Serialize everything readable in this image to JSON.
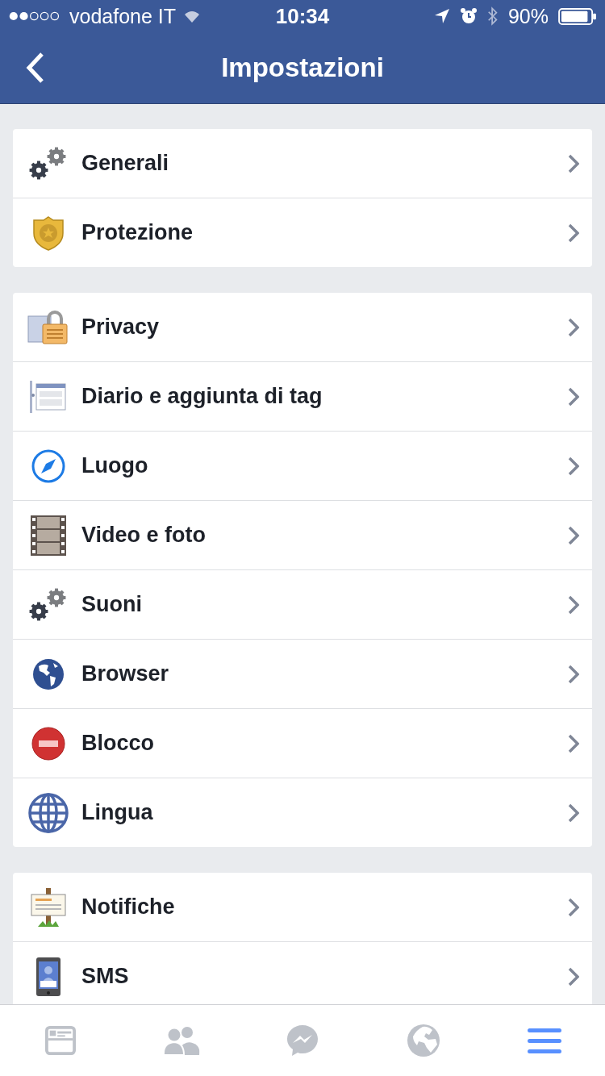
{
  "status_bar": {
    "carrier": "vodafone IT",
    "time": "10:34",
    "battery": "90%"
  },
  "nav_bar": {
    "title": "Impostazioni"
  },
  "sections": [
    {
      "items": [
        {
          "kind": "gears",
          "label": "Generali"
        },
        {
          "kind": "badge",
          "label": "Protezione"
        }
      ]
    },
    {
      "items": [
        {
          "kind": "lock",
          "label": "Privacy"
        },
        {
          "kind": "timeline",
          "label": "Diario e aggiunta di tag"
        },
        {
          "kind": "compass",
          "label": "Luogo"
        },
        {
          "kind": "film",
          "label": "Video e foto"
        },
        {
          "kind": "gears",
          "label": "Suoni"
        },
        {
          "kind": "earth",
          "label": "Browser"
        },
        {
          "kind": "block",
          "label": "Blocco"
        },
        {
          "kind": "globe",
          "label": "Lingua"
        }
      ]
    },
    {
      "items": [
        {
          "kind": "sign",
          "label": "Notifiche"
        },
        {
          "kind": "phone",
          "label": "SMS"
        }
      ]
    }
  ],
  "tab_bar": [
    {
      "kind": "feed",
      "selected": false
    },
    {
      "kind": "friends",
      "selected": false
    },
    {
      "kind": "messenger",
      "selected": false
    },
    {
      "kind": "world",
      "selected": false
    },
    {
      "kind": "menu",
      "selected": true
    }
  ]
}
